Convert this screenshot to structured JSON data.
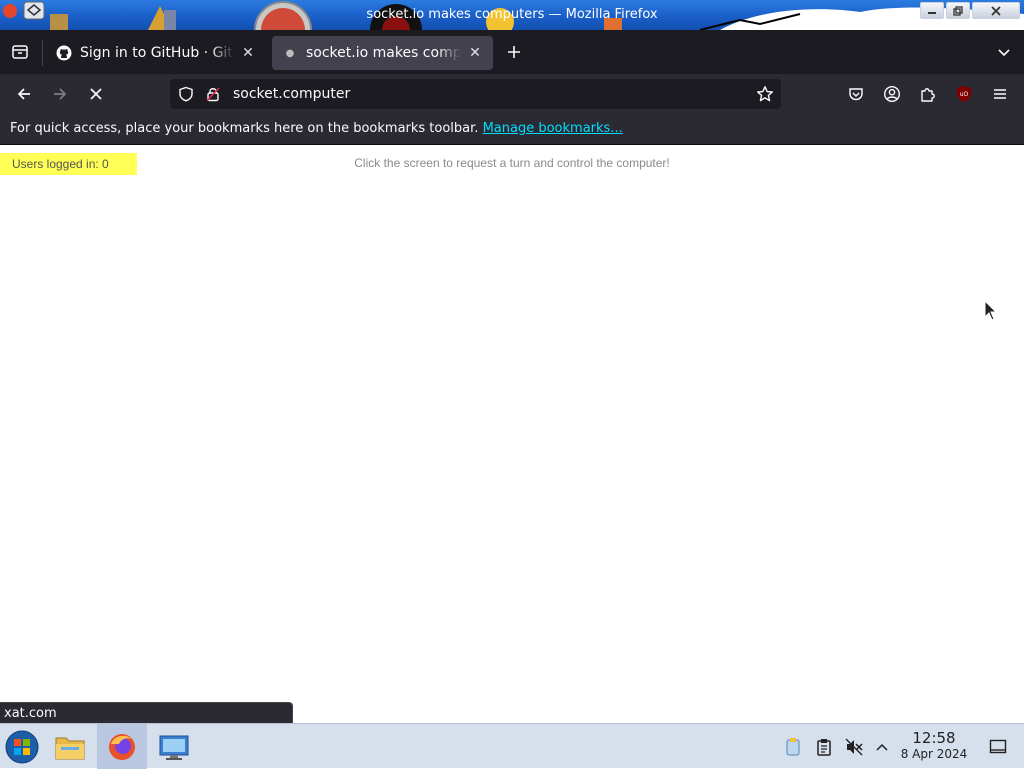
{
  "window": {
    "title": "socket.io makes computers — Mozilla Firefox"
  },
  "tabs": [
    {
      "label": "Sign in to GitHub · GitHub",
      "active": false,
      "icon": "github-icon"
    },
    {
      "label": "socket.io makes computers",
      "active": true,
      "icon": "loading-dot-icon"
    }
  ],
  "navbar": {
    "url": "socket.computer"
  },
  "bookmarks_bar": {
    "message": "For quick access, place your bookmarks here on the bookmarks toolbar.",
    "link_label": "Manage bookmarks..."
  },
  "page": {
    "users_label": "Users logged in: 0",
    "hint": "Click the screen to request a turn and control the computer!"
  },
  "status_bar": {
    "text": "xat.com"
  },
  "taskbar": {
    "time": "12:58",
    "date": "8 Apr 2024"
  },
  "colors": {
    "browser_dark": "#1c1b22",
    "toolbar": "#2b2a33",
    "link": "#00ddff",
    "badge": "#ffff55",
    "taskbar": "#d6dfec"
  }
}
